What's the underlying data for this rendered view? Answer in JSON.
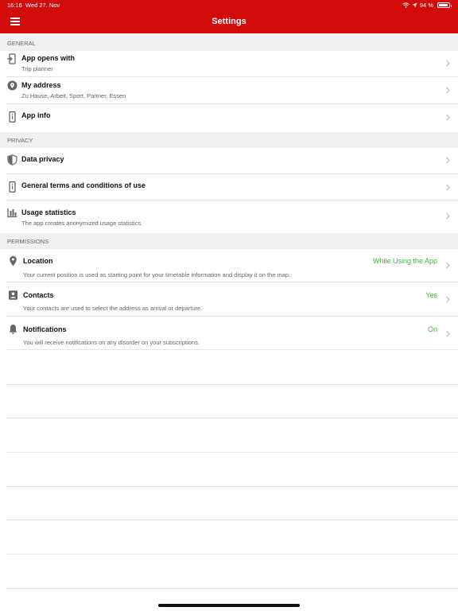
{
  "status": {
    "time": "16:16",
    "date": "Wed 27. Nov",
    "battery": "94 %"
  },
  "header": {
    "title": "Settings"
  },
  "sections": {
    "general": "GENERAL",
    "privacy": "PRIVACY",
    "permissions": "PERMISSIONS"
  },
  "general": {
    "app_opens": {
      "label": "App opens with",
      "sub": "Trip planner"
    },
    "my_address": {
      "label": "My address",
      "sub": "Zu Hause, Arbeit, Sport, Partner, Essen"
    },
    "app_info": {
      "label": "App info"
    }
  },
  "privacy": {
    "data_privacy": {
      "label": "Data privacy"
    },
    "terms": {
      "label": "General terms and conditions of use"
    },
    "usage": {
      "label": "Usage statistics",
      "sub": "The app creates anonymized usage statistics."
    }
  },
  "permissions": {
    "location": {
      "label": "Location",
      "value": "While Using the App",
      "sub": "Your current position is used as starting point for your timetable information and display it on the map."
    },
    "contacts": {
      "label": "Contacts",
      "value": "Yes",
      "sub": "Your contacts are used to select the address as arrival or departure."
    },
    "notifications": {
      "label": "Notifications",
      "value": "On",
      "sub": "You will receive notifications on any disorder on your subscriptions."
    }
  },
  "colors": {
    "header": "#d20b0b",
    "value_green": "#3fb53f",
    "section_bg": "#f0f0f0"
  }
}
